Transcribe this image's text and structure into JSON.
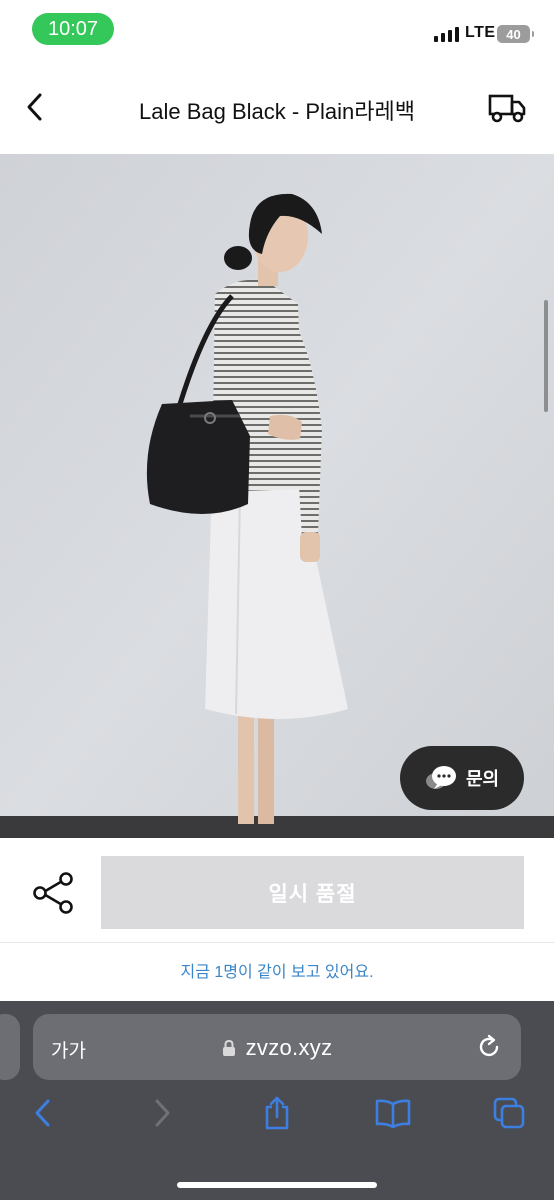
{
  "status_bar": {
    "time": "10:07",
    "network": "LTE",
    "battery": "40",
    "time_pill_color": "#34c759"
  },
  "header": {
    "title": "Lale Bag Black - Plain라레백",
    "back_icon": "chevron-left-icon",
    "delivery_icon": "truck-icon"
  },
  "product": {
    "image_description_icon": "product-photo",
    "inquiry_label": "문의",
    "inquiry_icon": "chat-bubbles-icon"
  },
  "actions": {
    "share_icon": "share-icon",
    "soldout_label": "일시 품절",
    "soldout_color": "#dadadd",
    "viewer_text": "지금 1명이 같이 보고 있어요.",
    "viewer_text_color": "#3a86c8"
  },
  "browser": {
    "aa_label": "가가",
    "url": "zvzo.xyz",
    "lock_icon": "lock-icon",
    "reload_icon": "reload-icon",
    "toolbar_icons": [
      "back-icon",
      "forward-icon",
      "share-icon",
      "bookmarks-icon",
      "tabs-icon"
    ],
    "accent": "#3d7fe0"
  }
}
